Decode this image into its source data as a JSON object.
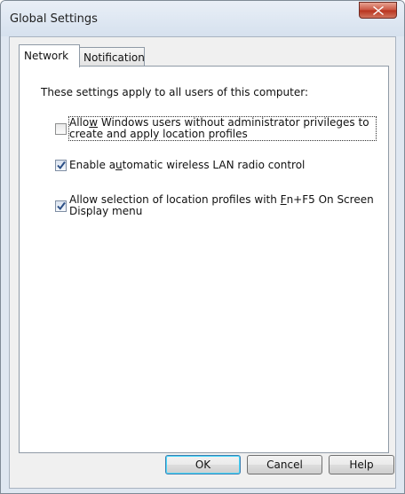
{
  "window": {
    "title": "Global Settings"
  },
  "tabs": [
    {
      "label": "Network",
      "selected": true
    },
    {
      "label": "Notification",
      "selected": false
    }
  ],
  "network_tab": {
    "intro": "These settings apply to all users of this computer:",
    "options": [
      {
        "label_before": "Allo",
        "label_mnemonic": "w",
        "label_after": " Windows users without administrator privileges to create and apply location profiles",
        "checked": false
      },
      {
        "label_before": "Enable a",
        "label_mnemonic": "u",
        "label_after": "tomatic wireless LAN radio control",
        "checked": true
      },
      {
        "label_before": "Allow selection of location profiles with ",
        "label_mnemonic": "F",
        "label_after": "n+F5 On Screen Display menu",
        "checked": true
      }
    ]
  },
  "buttons": {
    "ok": "OK",
    "cancel": "Cancel",
    "help": "Help"
  },
  "colors": {
    "close_button": "#c95440",
    "default_button_border": "#3c7fb1",
    "client_background": "#f0f0f0"
  }
}
